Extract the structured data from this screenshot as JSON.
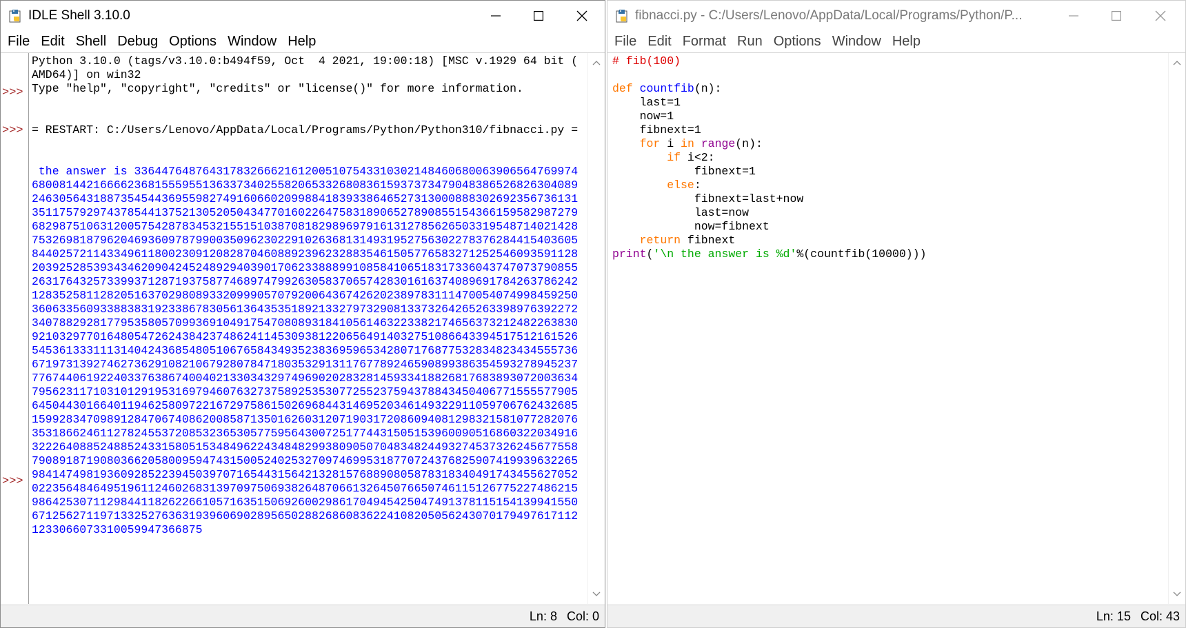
{
  "shell": {
    "title": "IDLE Shell 3.10.0",
    "menu": [
      "File",
      "Edit",
      "Shell",
      "Debug",
      "Options",
      "Window",
      "Help"
    ],
    "banner": [
      "Python 3.10.0 (tags/v3.10.0:b494f59, Oct  4 2021, 19:00:18) [MSC v.1929 64 bit (",
      "AMD64)] on win32",
      "Type \"help\", \"copyright\", \"credits\" or \"license()\" for more information."
    ],
    "prompt": ">>>",
    "restart": "= RESTART: C:/Users/Lenovo/AppData/Local/Programs/Python/Python310/fibnacci.py =",
    "answer_label": " the answer is ",
    "answer_lines": [
      "336447648764317832666216120051075433103021484606800639065647699746800814421666623681555955136337340255820653326808361593737347904838652682630408924630564318873545443695598274916066020998841839338646527313000888302692356736131351175792974378544137521305205043477016022647583189065278908551543661595829872796829875106312005754287834532155151038708182989697916131278562650331954871402142875326981879620469360978799003509623022910263681314931952756302278376284415403605844025721143349611800230912082870460889239623288354615057765832712525460935911282039252853934346209042452489294039017062338889910858410651831733604374707379085526317643257339937128719375877468974799263058370657428301616374089691784263786242128352581128205163702980893320999057079200643674262023897831114700540749984592503606335609338838319233867830561364353518921332797329081337326426526339897639227234078829281779535805709936910491754708089318410561463223382174656373212482263830921032977016480547262438423748624114530938122065649140327510866433945175121615265453613331113140424368548051067658434935238369596534280717687753283482343455573667197313927462736291082106792807847180353291311767789246590899386354593278945237776744061922403376386740040213303432974969020283281459334188268176838930720036347956231171031012919531697946076327375892535307725523759437884345040677155557790564504430166401194625809722167297586150269684431469520346149322911059706762432685159928347098912847067408620085871350162603120719031720860940812983215810772820763531866246112782455372085323653057759564300725177443150515396009051686032203491632226408852488524331580515348496224348482993809050704834824493274537326245677558790891871908036620580095947431500524025327097469953187707243768259074199396322659841474981936092852239450397071654431564213281576889080587831834049174345562705202235648464951961124602683139709750693826487066132645076650746115126775227486215986425307112984411826226610571635150692600298617049454250474913781151541399415506712562711971332527636319396069028956502882686083622410820505624307017949761711212330660733100599473668",
      "75"
    ],
    "status": {
      "ln": "Ln: 8",
      "col": "Col: 0"
    }
  },
  "editor": {
    "title": "fibnacci.py - C:/Users/Lenovo/AppData/Local/Programs/Python/P...",
    "menu": [
      "File",
      "Edit",
      "Format",
      "Run",
      "Options",
      "Window",
      "Help"
    ],
    "code": {
      "l1": "# fib(100)",
      "def_kw": "def",
      "func_name": "countfib",
      "func_args": "(n):",
      "l4": "    last=1",
      "l5": "    now=1",
      "l6": "    fibnext=1",
      "for_indent": "    ",
      "for_kw": "for",
      "for_i": " i ",
      "in_kw": "in",
      "sp": " ",
      "range_bi": "range",
      "range_rest": "(n):",
      "if_indent": "        ",
      "if_kw": "if",
      "if_rest": " i<2:",
      "l9": "            fibnext=1",
      "else_indent": "        ",
      "else_kw": "else",
      "else_rest": ":",
      "l11": "            fibnext=last+now",
      "l12": "            last=now",
      "l13": "            now=fibnext",
      "ret_indent": "    ",
      "ret_kw": "return",
      "ret_rest": " fibnext",
      "print_bi": "print",
      "print_open": "(",
      "print_str": "'\\n the answer is %d'",
      "print_rest": "%(countfib(10000)))"
    },
    "status": {
      "ln": "Ln: 15",
      "col": "Col: 43"
    }
  },
  "window_controls": {
    "minimize": "minimize-icon",
    "maximize": "maximize-icon",
    "close": "close-icon"
  }
}
